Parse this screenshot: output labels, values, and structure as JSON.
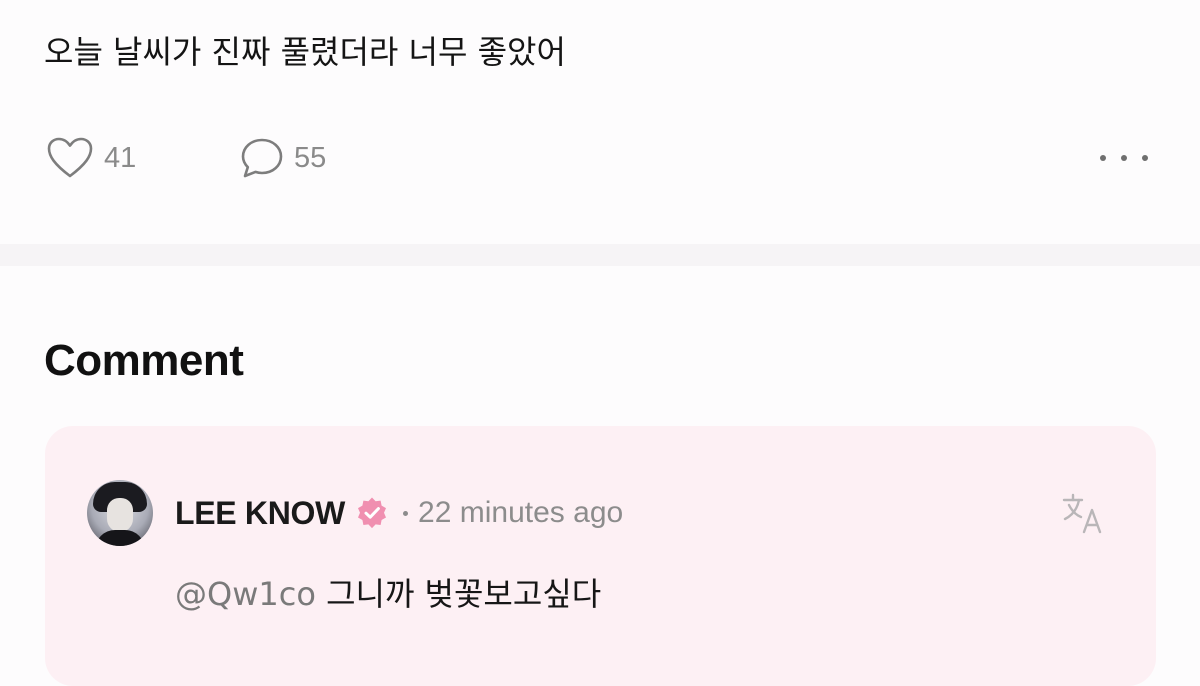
{
  "post": {
    "text": "오늘 날씨가 진짜 풀렸더라 너무 좋았어",
    "like_count": "41",
    "comment_count": "55",
    "like_icon": "heart-outline-icon",
    "comment_icon": "chat-bubble-icon",
    "more_icon": "more-horizontal-icon"
  },
  "comments_section": {
    "title": "Comment"
  },
  "comment": {
    "author": "LEE KNOW",
    "verified_icon": "verified-badge-icon",
    "separator": "·",
    "timestamp": "22 minutes ago",
    "mention": "@Qw1co",
    "text": "그니까 벚꽃보고싶다",
    "translate_icon": "translate-icon"
  },
  "colors": {
    "background": "#fdfcfd",
    "divider": "#f6f4f6",
    "comment_card": "#fdf0f4",
    "verified_badge": "#f08fb0",
    "muted_text": "#8c8c8c"
  }
}
